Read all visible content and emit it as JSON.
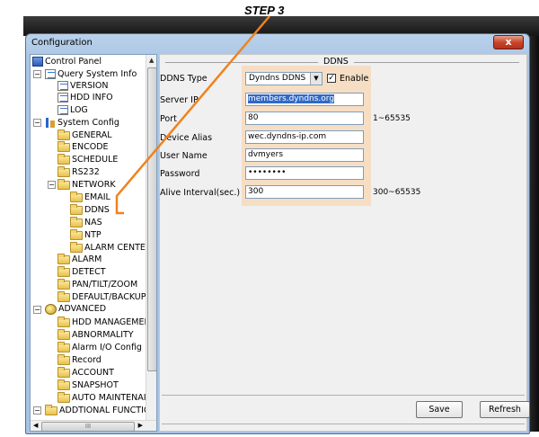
{
  "step_label": "STEP 3",
  "window": {
    "title": "Configuration",
    "close_glyph": "x"
  },
  "tree": {
    "items": [
      {
        "label": "Control Panel"
      },
      {
        "label": "Query System Info"
      },
      {
        "label": "VERSION"
      },
      {
        "label": "HDD INFO"
      },
      {
        "label": "LOG"
      },
      {
        "label": "System Config"
      },
      {
        "label": "GENERAL"
      },
      {
        "label": "ENCODE"
      },
      {
        "label": "SCHEDULE"
      },
      {
        "label": "RS232"
      },
      {
        "label": "NETWORK"
      },
      {
        "label": "EMAIL"
      },
      {
        "label": "DDNS"
      },
      {
        "label": "NAS"
      },
      {
        "label": "NTP"
      },
      {
        "label": "ALARM CENTE"
      },
      {
        "label": "ALARM"
      },
      {
        "label": "DETECT"
      },
      {
        "label": "PAN/TILT/ZOOM"
      },
      {
        "label": "DEFAULT/BACKUP"
      },
      {
        "label": "ADVANCED"
      },
      {
        "label": "HDD MANAGEMEI"
      },
      {
        "label": "ABNORMALITY"
      },
      {
        "label": "Alarm I/O Config"
      },
      {
        "label": "Record"
      },
      {
        "label": "ACCOUNT"
      },
      {
        "label": "SNAPSHOT"
      },
      {
        "label": "AUTO MAINTENAI"
      },
      {
        "label": "ADDTIONAL FUNCTIC"
      }
    ],
    "hscroll_grip": "III"
  },
  "ddns": {
    "section_title": "DDNS",
    "type_label": "DDNS Type",
    "type_value": "Dyndns DDNS",
    "enable_label": "Enable",
    "enable_checked": "✓",
    "server_ip_label": "Server IP",
    "server_ip_value": "members.dyndns.org",
    "port_label": "Port",
    "port_value": "80",
    "port_hint": "1~65535",
    "alias_label": "Device Alias",
    "alias_value": "wec.dyndns-ip.com",
    "username_label": "User Name",
    "username_value": "dvmyers",
    "password_label": "Password",
    "password_value": "••••••••",
    "alive_label": "Alive Interval(sec.)",
    "alive_value": "300",
    "alive_hint": "300~65535"
  },
  "buttons": {
    "save": "Save",
    "refresh": "Refresh"
  },
  "colors": {
    "highlight": "#f6dec4",
    "arrow": "#f0821e",
    "selection": "#3169c6"
  }
}
